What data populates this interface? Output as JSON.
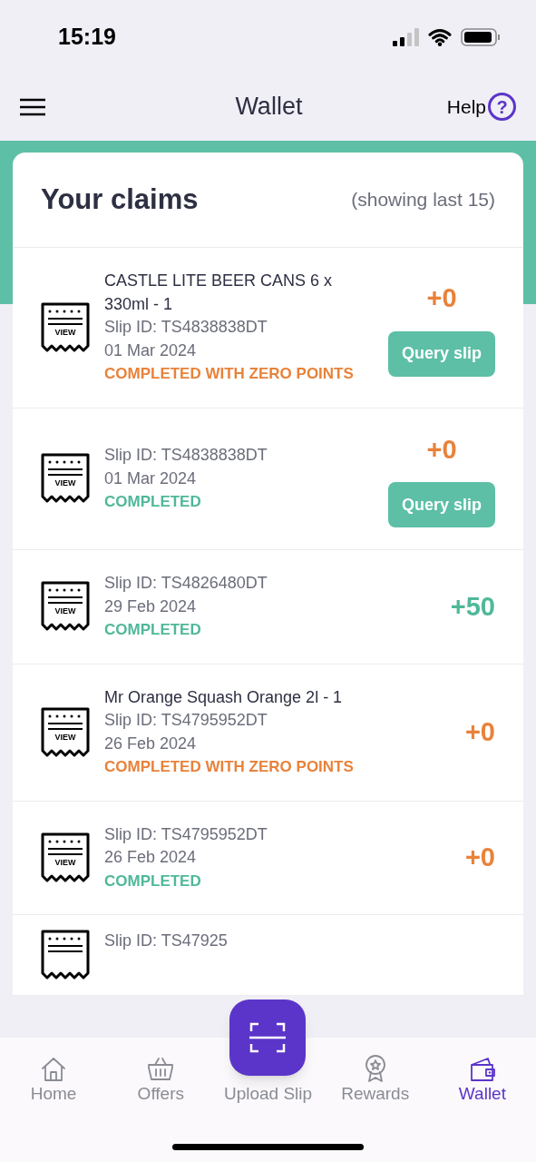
{
  "status_bar": {
    "time": "15:19"
  },
  "header": {
    "title": "Wallet",
    "help": "Help",
    "help_icon": "?"
  },
  "claims_card": {
    "title": "Your claims",
    "note": "(showing last 15)"
  },
  "claims": [
    {
      "icon_label": "VIEW",
      "name": "CASTLE LITE BEER CANS 6 x 330ml - 1",
      "slip_id": "Slip ID: TS4838838DT",
      "date": "01 Mar 2024",
      "status": {
        "text": "COMPLETED WITH ZERO POINTS",
        "kind": "zero"
      },
      "points": {
        "text": "+0",
        "kind": "zero"
      },
      "action": "Query slip"
    },
    {
      "icon_label": "VIEW",
      "slip_id": "Slip ID: TS4838838DT",
      "date": "01 Mar 2024",
      "status": {
        "text": "COMPLETED",
        "kind": "completed"
      },
      "points": {
        "text": "+0",
        "kind": "zero"
      },
      "action": "Query slip"
    },
    {
      "icon_label": "VIEW",
      "slip_id": "Slip ID: TS4826480DT",
      "date": "29 Feb 2024",
      "status": {
        "text": "COMPLETED",
        "kind": "completed"
      },
      "points": {
        "text": "+50",
        "kind": "earned"
      }
    },
    {
      "icon_label": "VIEW",
      "name": "Mr Orange Squash Orange 2l - 1",
      "slip_id": "Slip ID: TS4795952DT",
      "date": "26 Feb 2024",
      "status": {
        "text": "COMPLETED WITH ZERO POINTS",
        "kind": "zero"
      },
      "points": {
        "text": "+0",
        "kind": "zero"
      }
    },
    {
      "icon_label": "VIEW",
      "slip_id": "Slip ID: TS4795952DT",
      "date": "26 Feb 2024",
      "status": {
        "text": "COMPLETED",
        "kind": "completed"
      },
      "points": {
        "text": "+0",
        "kind": "zero"
      }
    },
    {
      "slip_id": "Slip ID: TS47925"
    }
  ],
  "bottom_nav": [
    {
      "label": "Home",
      "kind": "home",
      "selected": false
    },
    {
      "label": "Offers",
      "kind": "basket",
      "selected": false
    },
    {
      "label": "Upload Slip",
      "kind": "scan",
      "selected": false
    },
    {
      "label": "Rewards",
      "kind": "award",
      "selected": false
    },
    {
      "label": "Wallet",
      "kind": "wallet",
      "selected": true
    }
  ]
}
